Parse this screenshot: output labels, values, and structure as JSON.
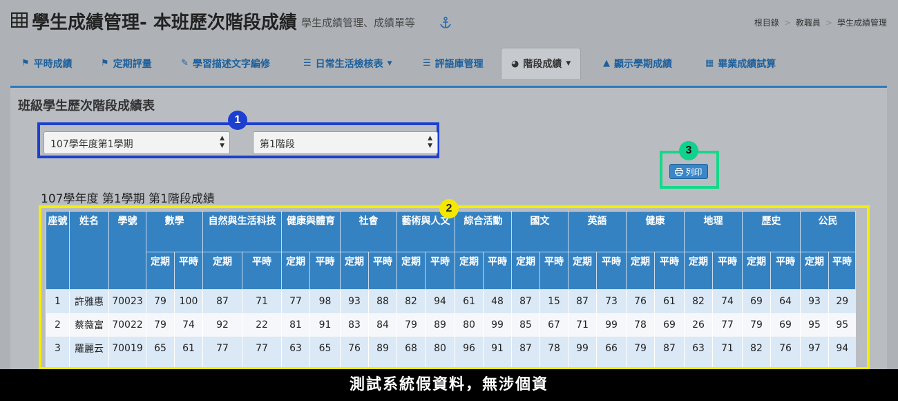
{
  "header": {
    "title": "學生成績管理- 本班歷次階段成績",
    "subtitle": "學生成績管理、成績單等",
    "breadcrumb": [
      "根目錄",
      "教職員",
      "學生成績管理"
    ]
  },
  "tabs": [
    {
      "label": "平時成績",
      "icon": "tag-icon"
    },
    {
      "label": "定期評量",
      "icon": "tags-icon"
    },
    {
      "label": "學習描述文字編修",
      "icon": "edit-icon"
    },
    {
      "label": "日常生活檢核表",
      "icon": "file-icon",
      "dropdown": true
    },
    {
      "label": "評語庫管理",
      "icon": "database-icon"
    },
    {
      "label": "階段成績",
      "icon": "pie-chart-icon",
      "dropdown": true,
      "active": true
    },
    {
      "label": "顯示學期成績",
      "icon": "area-chart-icon"
    },
    {
      "label": "畢業成績試算",
      "icon": "calculator-icon"
    }
  ],
  "panel": {
    "title": "班級學生歷次階段成績表",
    "semester_select": "107學年度第1學期",
    "stage_select": "第1階段",
    "print_label": "列印",
    "grade_title": "107學年度 第1學期 第1階段成績"
  },
  "badges": [
    "1",
    "2",
    "3"
  ],
  "table": {
    "fixed_headers": [
      "座號",
      "姓名",
      "學號"
    ],
    "subjects": [
      "數學",
      "自然與生活科技",
      "健康與體育",
      "社會",
      "藝術與人文",
      "綜合活動",
      "國文",
      "英語",
      "健康",
      "地理",
      "歷史",
      "公民"
    ],
    "sub_headers": [
      "定期",
      "平時"
    ],
    "rows": [
      {
        "seat": "1",
        "name": "許雅惠",
        "id": "70023",
        "scores": [
          "79",
          "100",
          "87",
          "71",
          "77",
          "98",
          "93",
          "88",
          "82",
          "94",
          "61",
          "48",
          "87",
          "15",
          "87",
          "73",
          "76",
          "61",
          "82",
          "74",
          "69",
          "64",
          "93",
          "29"
        ]
      },
      {
        "seat": "2",
        "name": "蔡薇富",
        "id": "70022",
        "scores": [
          "79",
          "74",
          "92",
          "22",
          "81",
          "91",
          "83",
          "84",
          "79",
          "89",
          "80",
          "99",
          "85",
          "67",
          "71",
          "99",
          "78",
          "69",
          "26",
          "77",
          "79",
          "69",
          "95",
          "95"
        ]
      },
      {
        "seat": "3",
        "name": "羅麗云",
        "id": "70019",
        "scores": [
          "65",
          "61",
          "77",
          "77",
          "63",
          "65",
          "76",
          "89",
          "68",
          "80",
          "96",
          "91",
          "87",
          "78",
          "99",
          "66",
          "79",
          "87",
          "63",
          "71",
          "82",
          "76",
          "97",
          "94"
        ]
      }
    ]
  },
  "footer": "測試系統假資料，無涉個資",
  "colors": {
    "accent": "#3582c2",
    "badge1": "#1d3fcf",
    "badge2": "#f4e800",
    "badge3": "#10d28c"
  }
}
